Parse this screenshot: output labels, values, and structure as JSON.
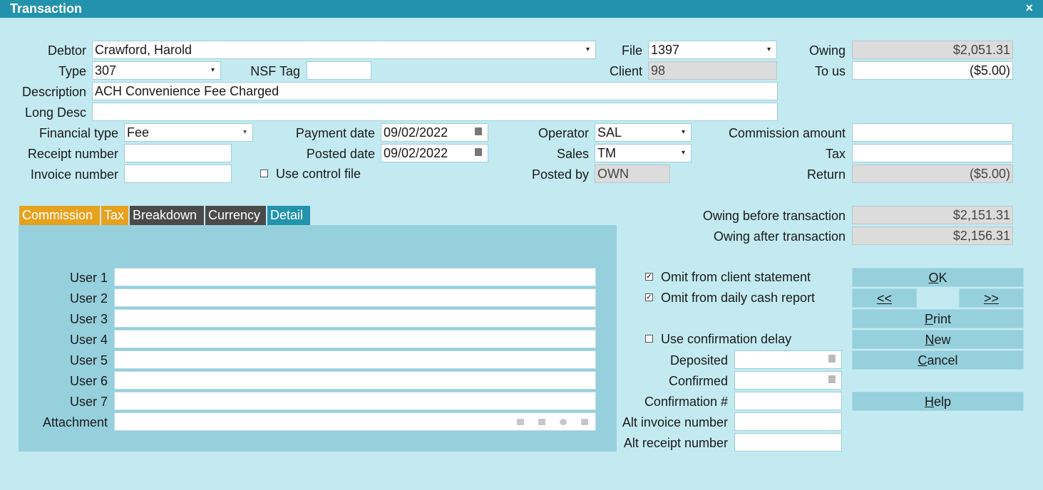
{
  "window": {
    "title": "Transaction",
    "close_glyph": "×"
  },
  "labels": {
    "debtor": "Debtor",
    "file": "File",
    "owing": "Owing",
    "type": "Type",
    "nsf_tag": "NSF Tag",
    "client": "Client",
    "to_us": "To us",
    "description": "Description",
    "long_desc": "Long Desc",
    "financial_type": "Financial type",
    "payment_date": "Payment date",
    "operator": "Operator",
    "commission_amount": "Commission amount",
    "receipt_number": "Receipt number",
    "posted_date": "Posted date",
    "sales": "Sales",
    "tax": "Tax",
    "invoice_number": "Invoice number",
    "use_control_file": "Use control file",
    "posted_by": "Posted by",
    "return": "Return",
    "owing_before": "Owing before transaction",
    "owing_after": "Owing after transaction",
    "omit_client_statement": "Omit from client statement",
    "omit_daily_cash": "Omit from daily cash report",
    "use_confirmation_delay": "Use confirmation delay",
    "deposited": "Deposited",
    "confirmed": "Confirmed",
    "confirmation_no": "Confirmation #",
    "alt_invoice": "Alt invoice number",
    "alt_receipt": "Alt receipt number"
  },
  "values": {
    "debtor": "Crawford, Harold",
    "file": "1397",
    "owing": "$2,051.31",
    "type": "307",
    "nsf_tag": "",
    "client": "98",
    "to_us": "($5.00)",
    "description": "ACH Convenience Fee Charged",
    "long_desc": "",
    "financial_type": "Fee",
    "payment_date": "09/02/2022",
    "operator": "SAL",
    "commission_amount": "",
    "receipt_number": "",
    "posted_date": "09/02/2022",
    "sales": "TM",
    "tax": "",
    "invoice_number": "",
    "posted_by": "OWN",
    "return": "($5.00)",
    "owing_before": "$2,151.31",
    "owing_after": "$2,156.31",
    "deposited": "",
    "confirmed": "",
    "confirmation_no": "",
    "alt_invoice": "",
    "alt_receipt": ""
  },
  "checkboxes": {
    "use_control_file": false,
    "omit_client_statement": true,
    "omit_daily_cash": true,
    "use_confirmation_delay": false
  },
  "tabs": [
    {
      "label": "Commission",
      "color": "#e6a21f"
    },
    {
      "label": "Tax",
      "color": "#e6a21f"
    },
    {
      "label": "Breakdown",
      "color": "#4a4a4a"
    },
    {
      "label": "Currency",
      "color": "#4a4a4a"
    },
    {
      "label": "Detail",
      "color": "#2393ad",
      "active": true
    }
  ],
  "detail": {
    "user_labels": [
      "User 1",
      "User 2",
      "User 3",
      "User 4",
      "User 5",
      "User 6",
      "User 7"
    ],
    "attachment_label": "Attachment",
    "attachment_icons": [
      "folder-icon",
      "scanner-icon",
      "clear-icon",
      "lock-icon"
    ]
  },
  "buttons": {
    "ok": {
      "u": "O",
      "rest": "K"
    },
    "prev": {
      "u": "<",
      "rest": "<"
    },
    "next": {
      "u": ">",
      "rest": ">"
    },
    "print": {
      "u": "P",
      "rest": "rint"
    },
    "new": {
      "u": "N",
      "rest": "ew"
    },
    "cancel": {
      "u": "C",
      "rest": "ancel"
    },
    "help": {
      "u": "H",
      "rest": "elp"
    }
  },
  "colors": {
    "title_bar": "#2393ad",
    "background": "#c4eaf1",
    "panel": "#96d0dc"
  },
  "icons": {
    "dropdown": "▾",
    "checkmark": "✓"
  }
}
